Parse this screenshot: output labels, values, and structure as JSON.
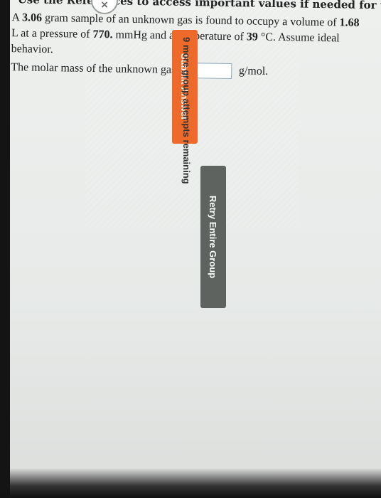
{
  "header": {
    "text": "Use the References to access important values if needed for this question."
  },
  "question": {
    "part1": "A ",
    "mass": "3.06",
    "part2": " gram sample of an unknown gas is found to occupy a volume of ",
    "volume": "1.68",
    "part3": " L at a pressure of ",
    "pressure": "770.",
    "part4": " mmHg and a temperature of ",
    "temperature": "39",
    "part5": " °C. Assume ideal behavior."
  },
  "answer": {
    "prompt": "The molar mass of the unknown gas is",
    "value": "",
    "unit": "g/mol."
  },
  "buttons": {
    "submit_label": "Submit Answer",
    "retry_label": "Retry Entire Group"
  },
  "status": {
    "attempts": "9 more group attempts remaining"
  },
  "colors": {
    "submit": "#ee6a2a",
    "retry": "#5e635f"
  }
}
